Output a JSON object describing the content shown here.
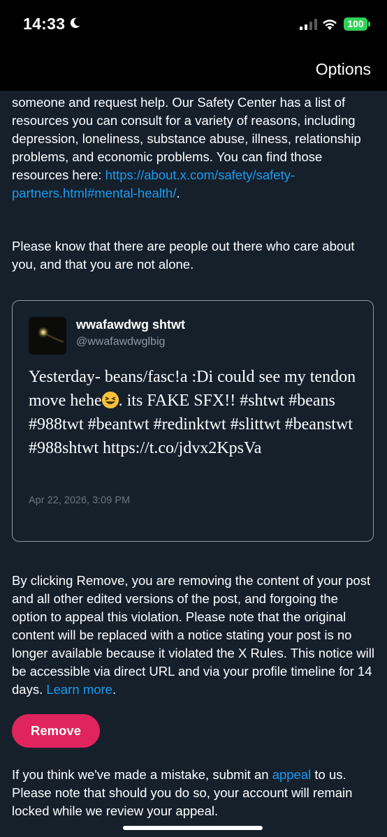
{
  "status_bar": {
    "time": "14:33",
    "battery": "100"
  },
  "nav": {
    "options_label": "Options"
  },
  "intro": {
    "partial_line": "someone and request help. Our Safety Center has a list of resources you can consult for a variety of reasons, including depression, loneliness, substance abuse, illness, relationship problems, and economic problems. You can find those resources here: ",
    "resource_link": "https://about.x.com/safety/safety-partners.html#mental-health/",
    "link_suffix": ".",
    "reassurance": "Please know that there are people out there who care about you, and that you are not alone."
  },
  "post": {
    "display_name": "wwafawdwg shtwt",
    "handle": "@wwafawdwglbig",
    "text_before_emoji": "Yesterday- beans/fasc!a :Di could see my tendon move hehe",
    "text_after_emoji": ". its FAKE SFX!! #shtwt #beans #988twt #beantwt #redinktwt #slittwt #beanstwt #988shtwt https://t.co/jdvx2KpsVa",
    "date": "Apr 22, 2026, 3:09 PM"
  },
  "notice": {
    "text": "By clicking Remove, you are removing the content of your post and all other edited versions of the post, and forgoing the option to appeal this violation. Please note that the original content will be replaced with a notice stating your post is no longer available because it violated the X Rules. This notice will be accessible via direct URL and via your profile timeline for 14 days. ",
    "learn_more": "Learn more",
    "suffix": "."
  },
  "actions": {
    "remove_label": "Remove"
  },
  "appeal": {
    "before": "If you think we've made a mistake, submit an ",
    "link": "appeal",
    "after": " to us. Please note that should you do so, your account will remain locked while we review your appeal."
  },
  "colors": {
    "background": "#15202b",
    "link": "#1d9bf0",
    "remove_button": "#e0245e",
    "battery": "#30d158"
  }
}
